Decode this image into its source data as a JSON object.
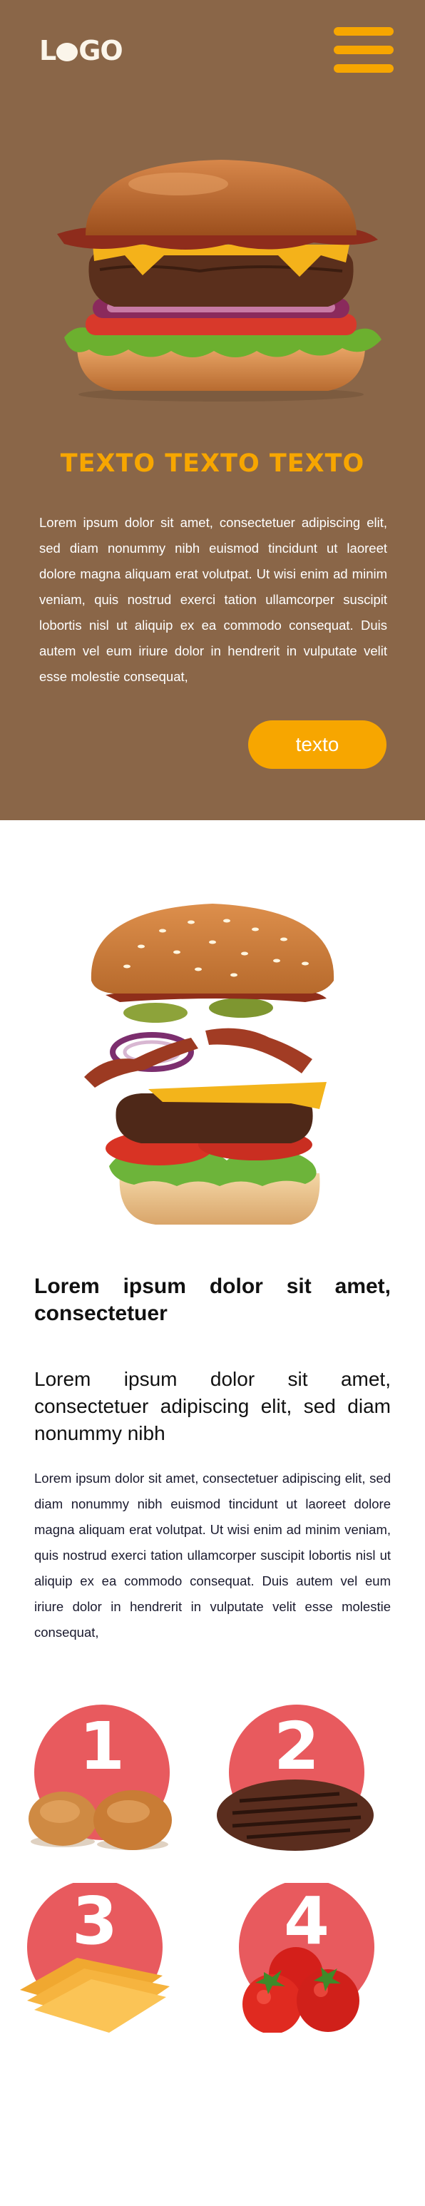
{
  "header": {
    "logo_text": "LOGO",
    "logo_text_before": "L",
    "logo_text_after": "GO"
  },
  "hero": {
    "title": "TEXTO TEXTO TEXTO",
    "text": "Lorem ipsum dolor sit amet, consectetuer adipiscing elit, sed diam nonummy nibh euismod tincidunt ut laoreet dolore magna aliquam erat volutpat. Ut wisi enim ad minim veniam, quis nostrud exerci tation ullamcorper suscipit lobortis nisl ut aliquip ex ea commodo consequat. Duis autem vel eum iriure dolor in hendrerit in vulputate velit esse molestie consequat,",
    "cta_label": "texto"
  },
  "section": {
    "heading": "Lorem ipsum dolor sit amet, consectetuer",
    "subheading": "Lorem ipsum dolor sit amet, consectetuer adipiscing elit, sed diam nonummy nibh",
    "body": "Lorem ipsum dolor sit amet, consectetuer adipiscing elit, sed diam nonummy nibh euismod tincidunt ut laoreet dolore magna aliquam erat volutpat. Ut wisi enim ad minim veniam, quis nostrud exerci tation ullamcorper suscipit lobortis nisl ut aliquip ex ea commodo consequat. Duis autem vel eum iriure dolor in hendrerit in vulputate velit esse molestie consequat,"
  },
  "steps": [
    {
      "number": "1",
      "icon": "bun-icon"
    },
    {
      "number": "2",
      "icon": "patty-icon"
    },
    {
      "number": "3",
      "icon": "cheese-icon"
    },
    {
      "number": "4",
      "icon": "tomato-icon"
    }
  ],
  "colors": {
    "hero_background": "#8a6648",
    "accent": "#f7a600",
    "step_circle": "#e85a5e",
    "logo": "#fbf5ea"
  }
}
